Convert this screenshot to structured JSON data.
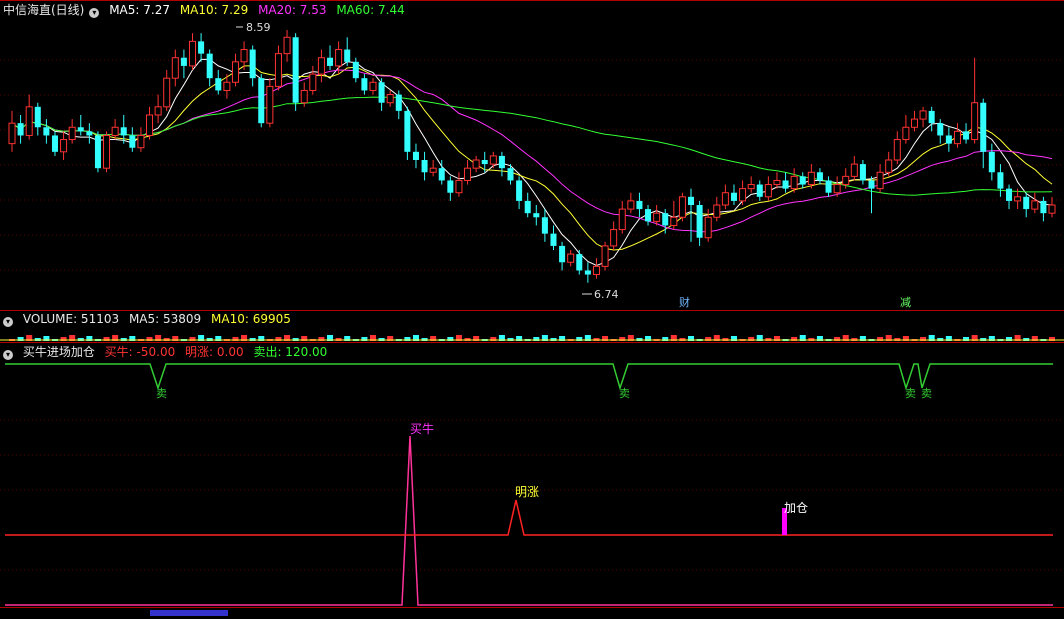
{
  "main_panel": {
    "title": "中信海直(日线)",
    "ma_labels": [
      {
        "text": "MA5: 7.27",
        "color": "#ffffff"
      },
      {
        "text": "MA10: 7.29",
        "color": "#ffff33"
      },
      {
        "text": "MA20: 7.53",
        "color": "#ff33ff"
      },
      {
        "text": "MA60: 7.44",
        "color": "#33ff33"
      }
    ],
    "high_label": "8.59",
    "low_label": "6.74",
    "event_tags": [
      {
        "text": "财",
        "color": "#6fb7ff"
      },
      {
        "text": "减",
        "color": "#66ff66"
      }
    ]
  },
  "volume_panel": {
    "labels": [
      {
        "text": "VOLUME: 51103",
        "color": "#e8e8e8"
      },
      {
        "text": "MA5: 53809",
        "color": "#e8e8e8"
      },
      {
        "text": "MA10: 69905",
        "color": "#ffff33"
      }
    ]
  },
  "indicator_panel": {
    "name": "买牛进场加仓",
    "labels": [
      {
        "text": "买牛: -50.00",
        "color": "#ff3333"
      },
      {
        "text": "明涨: 0.00",
        "color": "#ff3333"
      },
      {
        "text": "卖出: 120.00",
        "color": "#33ff33"
      }
    ],
    "sell_marks": [
      "卖",
      "卖",
      "卖",
      "卖"
    ],
    "buy_label": "买牛",
    "rise_label": "明涨",
    "add_label": "加仓"
  },
  "chart_data": {
    "type": "candlestick",
    "series": [
      {
        "name": "MA5",
        "color": "#ffffff"
      },
      {
        "name": "MA10",
        "color": "#ffff33"
      },
      {
        "name": "MA20",
        "color": "#ff33ff"
      },
      {
        "name": "MA60",
        "color": "#33ff33"
      }
    ],
    "candles": [
      [
        7.2,
        7.45,
        7.6,
        7.1
      ],
      [
        7.45,
        7.3,
        7.55,
        7.2
      ],
      [
        7.3,
        7.65,
        7.8,
        7.25
      ],
      [
        7.65,
        7.4,
        7.7,
        7.3
      ],
      [
        7.4,
        7.3,
        7.5,
        7.2
      ],
      [
        7.3,
        7.1,
        7.35,
        7.05
      ],
      [
        7.1,
        7.25,
        7.35,
        7.0
      ],
      [
        7.25,
        7.4,
        7.5,
        7.2
      ],
      [
        7.4,
        7.35,
        7.55,
        7.3
      ],
      [
        7.35,
        7.3,
        7.45,
        7.2
      ],
      [
        7.3,
        6.9,
        7.35,
        6.85
      ],
      [
        6.9,
        7.3,
        7.35,
        6.85
      ],
      [
        7.3,
        7.4,
        7.5,
        7.25
      ],
      [
        7.4,
        7.3,
        7.55,
        7.2
      ],
      [
        7.3,
        7.15,
        7.4,
        7.1
      ],
      [
        7.15,
        7.3,
        7.4,
        7.1
      ],
      [
        7.3,
        7.55,
        7.65,
        7.25
      ],
      [
        7.55,
        7.65,
        7.8,
        7.45
      ],
      [
        7.65,
        8.0,
        8.1,
        7.6
      ],
      [
        8.0,
        8.25,
        8.35,
        7.9
      ],
      [
        8.25,
        8.15,
        8.35,
        8.0
      ],
      [
        8.15,
        8.45,
        8.55,
        8.1
      ],
      [
        8.45,
        8.3,
        8.55,
        8.2
      ],
      [
        8.3,
        8.0,
        8.35,
        7.9
      ],
      [
        8.0,
        7.85,
        8.1,
        7.8
      ],
      [
        7.85,
        7.95,
        8.05,
        7.75
      ],
      [
        7.95,
        8.2,
        8.3,
        7.9
      ],
      [
        8.2,
        8.35,
        8.45,
        8.1
      ],
      [
        8.35,
        8.0,
        8.4,
        7.9
      ],
      [
        8.0,
        7.45,
        8.05,
        7.4
      ],
      [
        7.45,
        7.9,
        8.0,
        7.4
      ],
      [
        7.9,
        8.3,
        8.4,
        7.85
      ],
      [
        8.3,
        8.5,
        8.59,
        8.2
      ],
      [
        8.5,
        7.7,
        8.55,
        7.6
      ],
      [
        7.7,
        7.85,
        7.95,
        7.65
      ],
      [
        7.85,
        8.05,
        8.15,
        7.8
      ],
      [
        8.05,
        8.25,
        8.35,
        7.95
      ],
      [
        8.25,
        8.15,
        8.4,
        8.1
      ],
      [
        8.15,
        8.35,
        8.45,
        8.05
      ],
      [
        8.35,
        8.2,
        8.5,
        8.15
      ],
      [
        8.2,
        8.0,
        8.25,
        7.95
      ],
      [
        8.0,
        7.85,
        8.05,
        7.8
      ],
      [
        7.85,
        7.95,
        8.0,
        7.8
      ],
      [
        7.95,
        7.7,
        8.0,
        7.6
      ],
      [
        7.7,
        7.8,
        7.85,
        7.65
      ],
      [
        7.8,
        7.6,
        7.85,
        7.5
      ],
      [
        7.6,
        7.1,
        7.65,
        7.0
      ],
      [
        7.1,
        7.0,
        7.2,
        6.9
      ],
      [
        7.0,
        6.85,
        7.1,
        6.75
      ],
      [
        6.85,
        6.9,
        7.0,
        6.8
      ],
      [
        6.9,
        6.75,
        7.0,
        6.7
      ],
      [
        6.75,
        6.6,
        6.8,
        6.5
      ],
      [
        6.6,
        6.75,
        6.85,
        6.55
      ],
      [
        6.75,
        6.9,
        7.0,
        6.7
      ],
      [
        6.9,
        7.0,
        7.05,
        6.85
      ],
      [
        7.0,
        6.95,
        7.1,
        6.85
      ],
      [
        6.95,
        7.05,
        7.1,
        6.9
      ],
      [
        7.05,
        6.9,
        7.1,
        6.8
      ],
      [
        6.9,
        6.75,
        6.95,
        6.7
      ],
      [
        6.75,
        6.5,
        6.8,
        6.4
      ],
      [
        6.5,
        6.35,
        6.6,
        6.3
      ],
      [
        6.35,
        6.3,
        6.45,
        6.2
      ],
      [
        6.3,
        6.1,
        6.4,
        6.0
      ],
      [
        6.1,
        5.95,
        6.2,
        5.9
      ],
      [
        5.95,
        5.75,
        6.0,
        5.65
      ],
      [
        5.75,
        5.85,
        5.9,
        5.7
      ],
      [
        5.85,
        5.65,
        5.9,
        5.6
      ],
      [
        5.65,
        5.6,
        5.75,
        5.5
      ],
      [
        5.6,
        5.7,
        5.8,
        5.55
      ],
      [
        5.7,
        5.95,
        6.0,
        5.65
      ],
      [
        5.95,
        6.15,
        6.25,
        5.9
      ],
      [
        6.15,
        6.4,
        6.5,
        6.1
      ],
      [
        6.4,
        6.5,
        6.6,
        6.35
      ],
      [
        6.5,
        6.4,
        6.6,
        6.3
      ],
      [
        6.4,
        6.25,
        6.45,
        6.2
      ],
      [
        6.25,
        6.35,
        6.45,
        6.2
      ],
      [
        6.35,
        6.2,
        6.4,
        6.1
      ],
      [
        6.2,
        6.3,
        6.5,
        6.15
      ],
      [
        6.3,
        6.55,
        6.6,
        6.25
      ],
      [
        6.55,
        6.45,
        6.65,
        6.0
      ],
      [
        6.45,
        6.05,
        6.5,
        5.95
      ],
      [
        6.05,
        6.3,
        6.4,
        6.0
      ],
      [
        6.3,
        6.45,
        6.55,
        6.25
      ],
      [
        6.45,
        6.6,
        6.7,
        6.4
      ],
      [
        6.6,
        6.5,
        6.7,
        6.45
      ],
      [
        6.5,
        6.65,
        6.75,
        6.45
      ],
      [
        6.65,
        6.7,
        6.8,
        6.6
      ],
      [
        6.7,
        6.55,
        6.75,
        6.5
      ],
      [
        6.55,
        6.7,
        6.8,
        6.5
      ],
      [
        6.7,
        6.75,
        6.85,
        6.65
      ],
      [
        6.75,
        6.65,
        6.85,
        6.6
      ],
      [
        6.65,
        6.8,
        6.9,
        6.6
      ],
      [
        6.8,
        6.7,
        6.85,
        6.65
      ],
      [
        6.7,
        6.85,
        6.95,
        6.65
      ],
      [
        6.85,
        6.75,
        6.9,
        6.7
      ],
      [
        6.75,
        6.6,
        6.8,
        6.55
      ],
      [
        6.6,
        6.7,
        6.8,
        6.55
      ],
      [
        6.7,
        6.8,
        6.9,
        6.65
      ],
      [
        6.8,
        6.95,
        7.05,
        6.75
      ],
      [
        6.95,
        6.75,
        7.0,
        6.7
      ],
      [
        6.75,
        6.65,
        6.8,
        6.35
      ],
      [
        6.65,
        6.85,
        6.95,
        6.6
      ],
      [
        6.85,
        7.0,
        7.1,
        6.8
      ],
      [
        7.0,
        7.25,
        7.35,
        6.95
      ],
      [
        7.25,
        7.4,
        7.55,
        7.2
      ],
      [
        7.4,
        7.5,
        7.6,
        7.35
      ],
      [
        7.5,
        7.6,
        7.65,
        7.4
      ],
      [
        7.6,
        7.45,
        7.65,
        7.35
      ],
      [
        7.45,
        7.3,
        7.5,
        7.2
      ],
      [
        7.3,
        7.2,
        7.4,
        7.1
      ],
      [
        7.2,
        7.35,
        7.45,
        7.15
      ],
      [
        7.35,
        7.25,
        7.45,
        7.2
      ],
      [
        7.25,
        7.7,
        8.25,
        7.2
      ],
      [
        7.7,
        7.1,
        7.75,
        6.9
      ],
      [
        7.1,
        6.85,
        7.2,
        6.75
      ],
      [
        6.85,
        6.65,
        6.95,
        6.55
      ],
      [
        6.65,
        6.5,
        6.7,
        6.4
      ],
      [
        6.5,
        6.55,
        6.65,
        6.4
      ],
      [
        6.55,
        6.4,
        6.6,
        6.3
      ],
      [
        6.4,
        6.5,
        6.6,
        6.35
      ],
      [
        6.5,
        6.35,
        6.55,
        6.25
      ],
      [
        6.35,
        6.45,
        6.55,
        6.3
      ]
    ]
  }
}
